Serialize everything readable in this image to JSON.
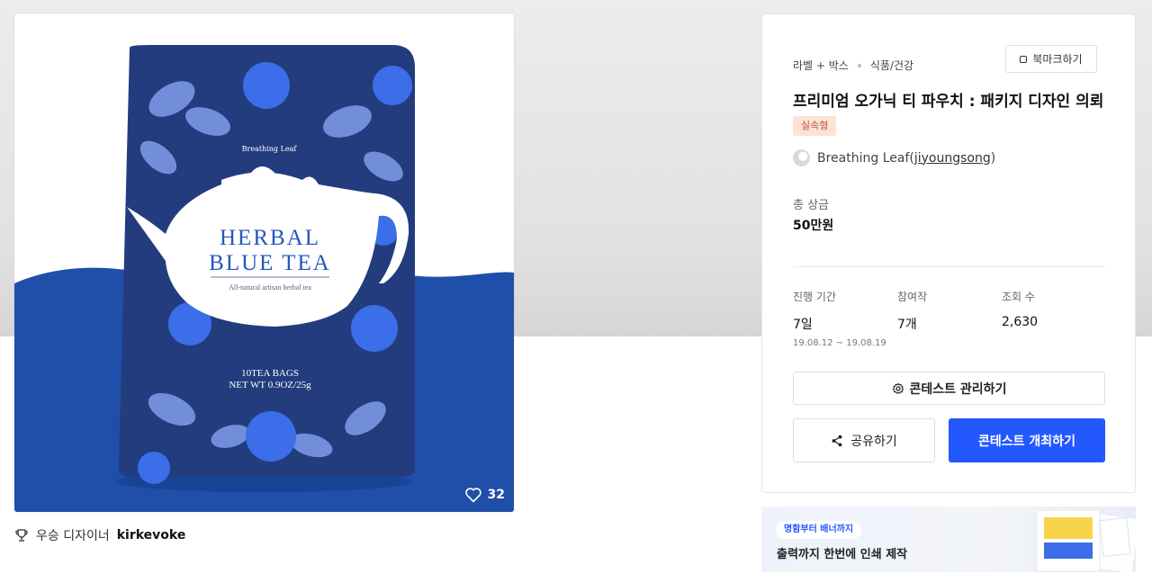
{
  "product": {
    "pouch_brand": "Breathing Leaf",
    "pouch_title_line1": "HERBAL",
    "pouch_title_line2": "BLUE TEA",
    "pouch_subtitle": "All-natural artisan herbal tea",
    "pouch_bags": "10TEA BAGS",
    "pouch_weight": "NET WT 0.9OZ/25g",
    "likes": "32"
  },
  "winner": {
    "prefix": "우승 디자이너",
    "name": "kirkevoke"
  },
  "info": {
    "category1": "라벨 + 박스",
    "category2": "식품/건강",
    "bookmark_label": "북마크하기",
    "title": "프리미엄 오가닉 티 파우치 : 패키지 디자인 의뢰",
    "tag": "실속형",
    "host_name": "Breathing Leaf",
    "host_id": "jiyoungsong",
    "prize_label": "총 상금",
    "prize_value": "50만원",
    "stats": [
      {
        "label": "진행 기간",
        "value": "7일",
        "sub": "19.08.12  ~  19.08.19"
      },
      {
        "label": "참여작",
        "value": "7개",
        "sub": ""
      },
      {
        "label": "조회 수",
        "value": "2,630",
        "sub": ""
      }
    ],
    "manage_label": "콘테스트 관리하기",
    "share_label": "공유하기",
    "open_label": "콘테스트 개최하기"
  },
  "banner": {
    "pill": "명함부터 배너까지",
    "text": "출력까지 한번에 인쇄 제작"
  },
  "colors": {
    "accent": "#2458ff",
    "pouch_navy": "#223c7e",
    "pouch_blue": "#1f4fa8",
    "tag_bg": "#fbe3d6"
  }
}
